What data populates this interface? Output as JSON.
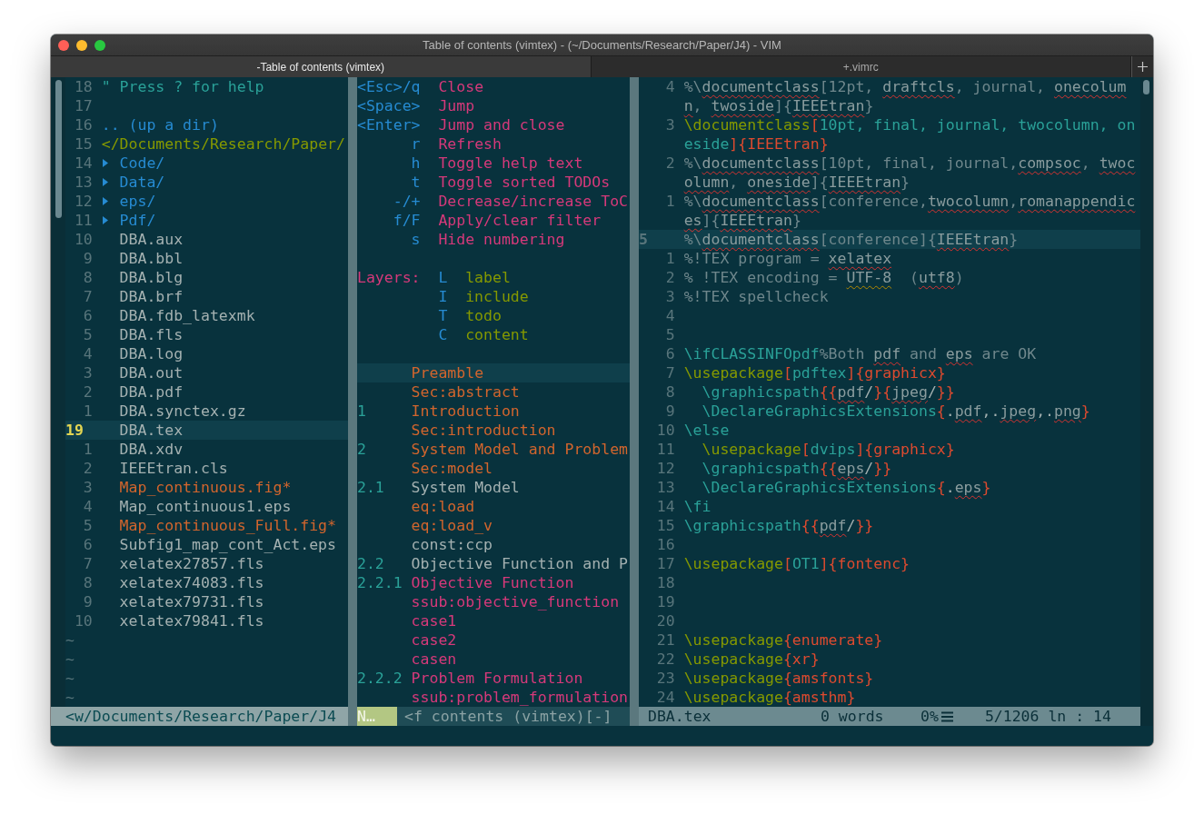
{
  "window": {
    "title": "Table of contents (vimtex) - (~/Documents/Research/Paper/J4) - VIM"
  },
  "tabs": [
    {
      "label": "-Table of contents (vimtex)",
      "selected": true
    },
    {
      "label": "+.vimrc",
      "selected": false
    }
  ],
  "file_tree": {
    "lines": [
      {
        "num": "18",
        "kind": "help",
        "text": "\" Press ? for help",
        "current": false
      },
      {
        "num": "17",
        "kind": "blank",
        "current": false
      },
      {
        "num": "16",
        "kind": "updir",
        "text": ".. (up a dir)",
        "current": false
      },
      {
        "num": "15",
        "kind": "path",
        "text": "</Documents/Research/Paper/",
        "current": false
      },
      {
        "num": "14",
        "kind": "dir",
        "text": "Code/",
        "expanded": false,
        "current": false
      },
      {
        "num": "13",
        "kind": "dir",
        "text": "Data/",
        "expanded": false,
        "current": false
      },
      {
        "num": "12",
        "kind": "dir",
        "text": "eps/",
        "expanded": false,
        "current": false
      },
      {
        "num": "11",
        "kind": "dir",
        "text": "Pdf/",
        "expanded": false,
        "current": false
      },
      {
        "num": "10",
        "kind": "file",
        "text": "DBA.aux",
        "current": false
      },
      {
        "num": "9",
        "kind": "file",
        "text": "DBA.bbl",
        "current": false
      },
      {
        "num": "8",
        "kind": "file",
        "text": "DBA.blg",
        "current": false
      },
      {
        "num": "7",
        "kind": "file",
        "text": "DBA.brf",
        "current": false
      },
      {
        "num": "6",
        "kind": "file",
        "text": "DBA.fdb_latexmk",
        "current": false
      },
      {
        "num": "5",
        "kind": "file",
        "text": "DBA.fls",
        "current": false
      },
      {
        "num": "4",
        "kind": "file",
        "text": "DBA.log",
        "current": false
      },
      {
        "num": "3",
        "kind": "file",
        "text": "DBA.out",
        "current": false
      },
      {
        "num": "2",
        "kind": "file",
        "text": "DBA.pdf",
        "current": false
      },
      {
        "num": "1",
        "kind": "file",
        "text": "DBA.synctex.gz",
        "current": false
      },
      {
        "num": "19",
        "kind": "file",
        "text": "DBA.tex",
        "current": true
      },
      {
        "num": "1",
        "kind": "file",
        "text": "DBA.xdv",
        "current": false
      },
      {
        "num": "2",
        "kind": "file",
        "text": "IEEEtran.cls",
        "current": false
      },
      {
        "num": "3",
        "kind": "modified",
        "text": "Map_continuous.fig*",
        "current": false
      },
      {
        "num": "4",
        "kind": "file",
        "text": "Map_continuous1.eps",
        "current": false
      },
      {
        "num": "5",
        "kind": "modified",
        "text": "Map_continuous_Full.fig*",
        "current": false
      },
      {
        "num": "6",
        "kind": "file",
        "text": "Subfig1_map_cont_Act.eps",
        "current": false
      },
      {
        "num": "7",
        "kind": "file",
        "text": "xelatex27857.fls",
        "current": false
      },
      {
        "num": "8",
        "kind": "file",
        "text": "xelatex74083.fls",
        "current": false
      },
      {
        "num": "9",
        "kind": "file",
        "text": "xelatex79731.fls",
        "current": false
      },
      {
        "num": "10",
        "kind": "file",
        "text": "xelatex79841.fls",
        "current": false
      }
    ],
    "empty_lines": [
      "~",
      "~",
      "~",
      "~"
    ]
  },
  "toc_pane": {
    "help": [
      {
        "key": "<Esc>/q",
        "action": "Close"
      },
      {
        "key": "<Space>",
        "action": "Jump"
      },
      {
        "key": "<Enter>",
        "action": "Jump and close"
      },
      {
        "key": "r",
        "action": "Refresh"
      },
      {
        "key": "h",
        "action": "Toggle help text"
      },
      {
        "key": "t",
        "action": "Toggle sorted TODOs"
      },
      {
        "key": "-/+",
        "action": "Decrease/increase ToC"
      },
      {
        "key": "f/F",
        "action": "Apply/clear filter"
      },
      {
        "key": "s",
        "action": "Hide numbering"
      }
    ],
    "layers": {
      "label": "Layers:",
      "items": [
        {
          "key": "L",
          "name": "label"
        },
        {
          "key": "I",
          "name": "include"
        },
        {
          "key": "T",
          "name": "todo"
        },
        {
          "key": "C",
          "name": "content"
        }
      ]
    },
    "entries": [
      {
        "title": "Preamble",
        "color": "#d2652d",
        "current": true
      },
      {
        "title": "Sec:abstract",
        "color": "#d2652d",
        "current": false
      },
      {
        "number": "1",
        "title": "Introduction",
        "color": "#d2652d",
        "current": false
      },
      {
        "title": "Sec:introduction",
        "color": "#d2652d",
        "current": false
      },
      {
        "number": "2",
        "title": "System Model and Problem",
        "color": "#d2652d",
        "current": false
      },
      {
        "title": "Sec:model",
        "color": "#d2652d",
        "current": false
      },
      {
        "number": "2.1",
        "title": "System Model",
        "color": "#a4b1b1",
        "current": false
      },
      {
        "title": "eq:load",
        "color": "#d2652d",
        "current": false
      },
      {
        "title": "eq:load_v",
        "color": "#d2652d",
        "current": false
      },
      {
        "title": "const:ccp",
        "color": "#a4b1b1",
        "current": false
      },
      {
        "number": "2.2",
        "title": "Objective Function and P",
        "color": "#a4b1b1",
        "current": false
      },
      {
        "number": "2.2.1",
        "title": "Objective Function",
        "color": "#d6397a",
        "current": false
      },
      {
        "title": "ssub:objective_function",
        "color": "#d6397a",
        "current": false
      },
      {
        "title": "case1",
        "color": "#d6397a",
        "current": false
      },
      {
        "title": "case2",
        "color": "#d6397a",
        "current": false
      },
      {
        "title": "casen",
        "color": "#d6397a",
        "current": false
      },
      {
        "number": "2.2.2",
        "title": "Problem Formulation",
        "color": "#d6397a",
        "current": false
      },
      {
        "title": "ssub:problem_formulation",
        "color": "#d6397a",
        "current": false
      }
    ]
  },
  "editor": {
    "lines": [
      {
        "num": "4",
        "current": false,
        "segments": [
          {
            "kind": "comment",
            "text": "%\\"
          },
          {
            "kind": "spell",
            "text": "documentclass"
          },
          {
            "kind": "comment",
            "text": "[12pt, "
          },
          {
            "kind": "spell",
            "text": "draftcls"
          },
          {
            "kind": "comment",
            "text": ", journal, "
          },
          {
            "kind": "spell",
            "text": "onecolumn"
          },
          {
            "kind": "comment",
            "text": ", "
          },
          {
            "kind": "spell",
            "text": "twoside"
          },
          {
            "kind": "comment",
            "text": "]{"
          },
          {
            "kind": "spell",
            "text": "IEEEtran"
          },
          {
            "kind": "comment",
            "text": "}"
          }
        ]
      },
      {
        "num": "3",
        "current": false,
        "segments": [
          {
            "kind": "command",
            "text": "\\documentclass"
          },
          {
            "kind": "delim",
            "text": "["
          },
          {
            "kind": "option",
            "text": "10pt, final, journal, twocolumn, oneside"
          },
          {
            "kind": "delim",
            "text": "]{IEEEtran}"
          }
        ]
      },
      {
        "num": "2",
        "current": false,
        "segments": [
          {
            "kind": "comment",
            "text": "%\\"
          },
          {
            "kind": "spell",
            "text": "documentclass"
          },
          {
            "kind": "comment",
            "text": "[10pt, final, journal,"
          },
          {
            "kind": "spell",
            "text": "compsoc"
          },
          {
            "kind": "comment",
            "text": ", "
          },
          {
            "kind": "spell",
            "text": "twocolumn"
          },
          {
            "kind": "comment",
            "text": ", "
          },
          {
            "kind": "spell",
            "text": "oneside"
          },
          {
            "kind": "comment",
            "text": "]{"
          },
          {
            "kind": "spell",
            "text": "IEEEtran"
          },
          {
            "kind": "comment",
            "text": "}"
          }
        ]
      },
      {
        "num": "1",
        "current": false,
        "segments": [
          {
            "kind": "comment",
            "text": "%\\"
          },
          {
            "kind": "spell",
            "text": "documentclass"
          },
          {
            "kind": "comment",
            "text": "[conference,"
          },
          {
            "kind": "spell",
            "text": "twocolumn"
          },
          {
            "kind": "comment",
            "text": ","
          },
          {
            "kind": "spell",
            "text": "romanappendices"
          },
          {
            "kind": "comment",
            "text": "]{"
          },
          {
            "kind": "spell",
            "text": "IEEEtran"
          },
          {
            "kind": "comment",
            "text": "}"
          }
        ]
      },
      {
        "num": "5",
        "current": true,
        "segments": [
          {
            "kind": "comment",
            "text": "%\\"
          },
          {
            "kind": "spell",
            "text": "documentclass"
          },
          {
            "kind": "comment",
            "text": "[conference]{"
          },
          {
            "kind": "spell",
            "text": "IEEEtran"
          },
          {
            "kind": "comment",
            "text": "}"
          }
        ]
      },
      {
        "num": "1",
        "current": false,
        "segments": [
          {
            "kind": "comment",
            "text": "%!TEX program = "
          },
          {
            "kind": "spell",
            "text": "xelatex"
          }
        ]
      },
      {
        "num": "2",
        "current": false,
        "segments": [
          {
            "kind": "comment",
            "text": "% !TEX encoding = "
          },
          {
            "kind": "rare",
            "text": "UTF-8"
          },
          {
            "kind": "comment",
            "text": "  ("
          },
          {
            "kind": "spell",
            "text": "utf8"
          },
          {
            "kind": "comment",
            "text": ")"
          }
        ]
      },
      {
        "num": "3",
        "current": false,
        "segments": [
          {
            "kind": "comment",
            "text": "%!TEX spellcheck"
          }
        ]
      },
      {
        "num": "4",
        "current": false
      },
      {
        "num": "5",
        "current": false
      },
      {
        "num": "6",
        "current": false,
        "segments": [
          {
            "kind": "macro",
            "text": "\\ifCLASSINFOpdf"
          },
          {
            "kind": "comment",
            "text": "%Both "
          },
          {
            "kind": "spell",
            "text": "pdf"
          },
          {
            "kind": "comment",
            "text": " and "
          },
          {
            "kind": "spell",
            "text": "eps"
          },
          {
            "kind": "comment",
            "text": " are OK"
          }
        ]
      },
      {
        "num": "7",
        "current": false,
        "segments": [
          {
            "kind": "command",
            "text": "\\usepackage"
          },
          {
            "kind": "delim",
            "text": "["
          },
          {
            "kind": "option",
            "text": "pdftex"
          },
          {
            "kind": "delim",
            "text": "]{graphicx}"
          }
        ]
      },
      {
        "num": "8",
        "current": false,
        "segments": [
          {
            "kind": "macro",
            "text": "  \\graphicspath"
          },
          {
            "kind": "delim",
            "text": "{{"
          },
          {
            "kind": "spell",
            "text": "pdf"
          },
          {
            "kind": "plain",
            "text": "/"
          },
          {
            "kind": "delim",
            "text": "}{"
          },
          {
            "kind": "spell",
            "text": "jpeg"
          },
          {
            "kind": "plain",
            "text": "/"
          },
          {
            "kind": "delim",
            "text": "}}"
          }
        ]
      },
      {
        "num": "9",
        "current": false,
        "segments": [
          {
            "kind": "macro",
            "text": "  \\DeclareGraphicsExtensions"
          },
          {
            "kind": "delim",
            "text": "{"
          },
          {
            "kind": "plain",
            "text": "."
          },
          {
            "kind": "spell",
            "text": "pdf"
          },
          {
            "kind": "plain",
            "text": ",."
          },
          {
            "kind": "spell",
            "text": "jpeg"
          },
          {
            "kind": "plain",
            "text": ",."
          },
          {
            "kind": "spell",
            "text": "png"
          },
          {
            "kind": "delim",
            "text": "}"
          }
        ]
      },
      {
        "num": "10",
        "current": false,
        "segments": [
          {
            "kind": "macro",
            "text": "\\else"
          }
        ]
      },
      {
        "num": "11",
        "current": false,
        "segments": [
          {
            "kind": "command",
            "text": "  \\usepackage"
          },
          {
            "kind": "delim",
            "text": "["
          },
          {
            "kind": "option",
            "text": "dvips"
          },
          {
            "kind": "delim",
            "text": "]{graphicx}"
          }
        ]
      },
      {
        "num": "12",
        "current": false,
        "segments": [
          {
            "kind": "macro",
            "text": "  \\graphicspath"
          },
          {
            "kind": "delim",
            "text": "{{"
          },
          {
            "kind": "spell",
            "text": "eps"
          },
          {
            "kind": "plain",
            "text": "/"
          },
          {
            "kind": "delim",
            "text": "}}"
          }
        ]
      },
      {
        "num": "13",
        "current": false,
        "segments": [
          {
            "kind": "macro",
            "text": "  \\DeclareGraphicsExtensions"
          },
          {
            "kind": "delim",
            "text": "{"
          },
          {
            "kind": "plain",
            "text": "."
          },
          {
            "kind": "spell",
            "text": "eps"
          },
          {
            "kind": "delim",
            "text": "}"
          }
        ]
      },
      {
        "num": "14",
        "current": false,
        "segments": [
          {
            "kind": "macro",
            "text": "\\fi"
          }
        ]
      },
      {
        "num": "15",
        "current": false,
        "segments": [
          {
            "kind": "macro",
            "text": "\\graphicspath"
          },
          {
            "kind": "delim",
            "text": "{{"
          },
          {
            "kind": "spell",
            "text": "pdf"
          },
          {
            "kind": "plain",
            "text": "/"
          },
          {
            "kind": "delim",
            "text": "}}"
          }
        ]
      },
      {
        "num": "16",
        "current": false
      },
      {
        "num": "17",
        "current": false,
        "segments": [
          {
            "kind": "command",
            "text": "\\usepackage"
          },
          {
            "kind": "delim",
            "text": "["
          },
          {
            "kind": "option",
            "text": "OT1"
          },
          {
            "kind": "delim",
            "text": "]{fontenc}"
          }
        ]
      },
      {
        "num": "18",
        "current": false
      },
      {
        "num": "19",
        "current": false
      },
      {
        "num": "20",
        "current": false
      },
      {
        "num": "21",
        "current": false,
        "segments": [
          {
            "kind": "command",
            "text": "\\usepackage"
          },
          {
            "kind": "delim",
            "text": "{enumerate}"
          }
        ]
      },
      {
        "num": "22",
        "current": false,
        "segments": [
          {
            "kind": "command",
            "text": "\\usepackage"
          },
          {
            "kind": "delim",
            "text": "{xr}"
          }
        ]
      },
      {
        "num": "23",
        "current": false,
        "segments": [
          {
            "kind": "command",
            "text": "\\usepackage"
          },
          {
            "kind": "delim",
            "text": "{amsfonts}"
          }
        ]
      },
      {
        "num": "24",
        "current": false,
        "segments": [
          {
            "kind": "command",
            "text": "\\usepackage"
          },
          {
            "kind": "delim",
            "text": "{amsthm}"
          }
        ]
      }
    ]
  },
  "status_bar": {
    "tree_path": "<w/Documents/Research/Paper/J4",
    "mode": "N…",
    "toc_buffer": "<f contents (vimtex)[-]",
    "file": "DBA.tex",
    "words": "0 words",
    "percent": "0%",
    "position": "5/1206 ln : 14"
  }
}
